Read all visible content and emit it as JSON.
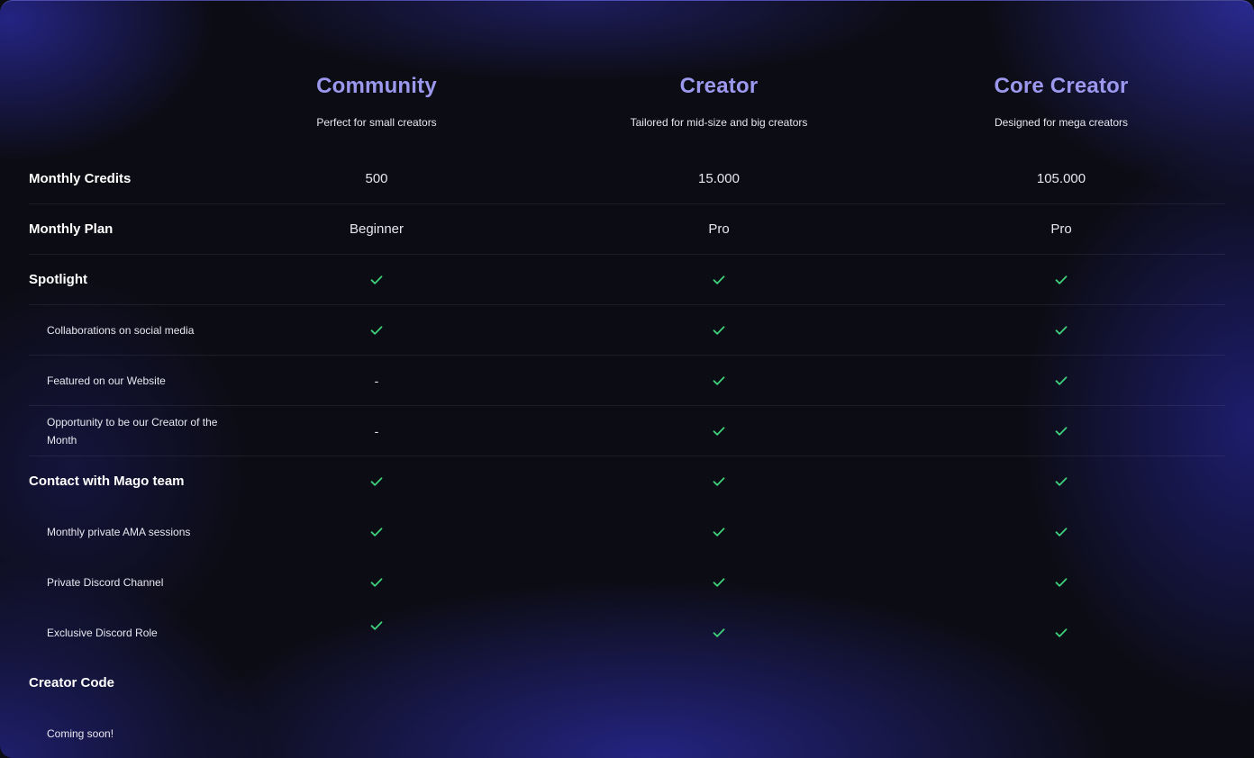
{
  "plans": [
    {
      "name": "Community",
      "description": "Perfect for small creators"
    },
    {
      "name": "Creator",
      "description": "Tailored for mid-size and big creators"
    },
    {
      "name": "Core Creator",
      "description": "Designed for mega creators"
    }
  ],
  "rows": {
    "monthly_credits": {
      "label": "Monthly Credits",
      "values": [
        "500",
        "15.000",
        "105.000"
      ]
    },
    "monthly_plan": {
      "label": "Monthly Plan",
      "values": [
        "Beginner",
        "Pro",
        "Pro"
      ]
    },
    "spotlight": {
      "label": "Spotlight",
      "values": [
        "check",
        "check",
        "check"
      ]
    },
    "collaborations": {
      "label": "Collaborations on social media",
      "values": [
        "check",
        "check",
        "check"
      ]
    },
    "featured_website": {
      "label": "Featured on our Website",
      "values": [
        "-",
        "check",
        "check"
      ]
    },
    "creator_of_month": {
      "label": "Opportunity to be our Creator of the Month",
      "values": [
        "-",
        "check",
        "check"
      ]
    },
    "contact_team": {
      "label": "Contact with Mago team",
      "values": [
        "check",
        "check",
        "check"
      ]
    },
    "ama_sessions": {
      "label": "Monthly private AMA sessions",
      "values": [
        "check",
        "check",
        "check"
      ]
    },
    "discord_channel": {
      "label": "Private Discord Channel",
      "values": [
        "check",
        "check",
        "check"
      ]
    },
    "discord_role": {
      "label": "Exclusive Discord Role",
      "values": [
        "check",
        "check",
        "check"
      ]
    },
    "creator_code": {
      "label": "Creator Code",
      "values": []
    },
    "coming_soon": {
      "label": "Coming soon!",
      "values": []
    }
  },
  "colors": {
    "plan_name": "#9b98ee",
    "check": "#3fd07a",
    "background": "#0c0c14",
    "glow": "#28289a"
  },
  "icons": {
    "included": "check-icon"
  }
}
